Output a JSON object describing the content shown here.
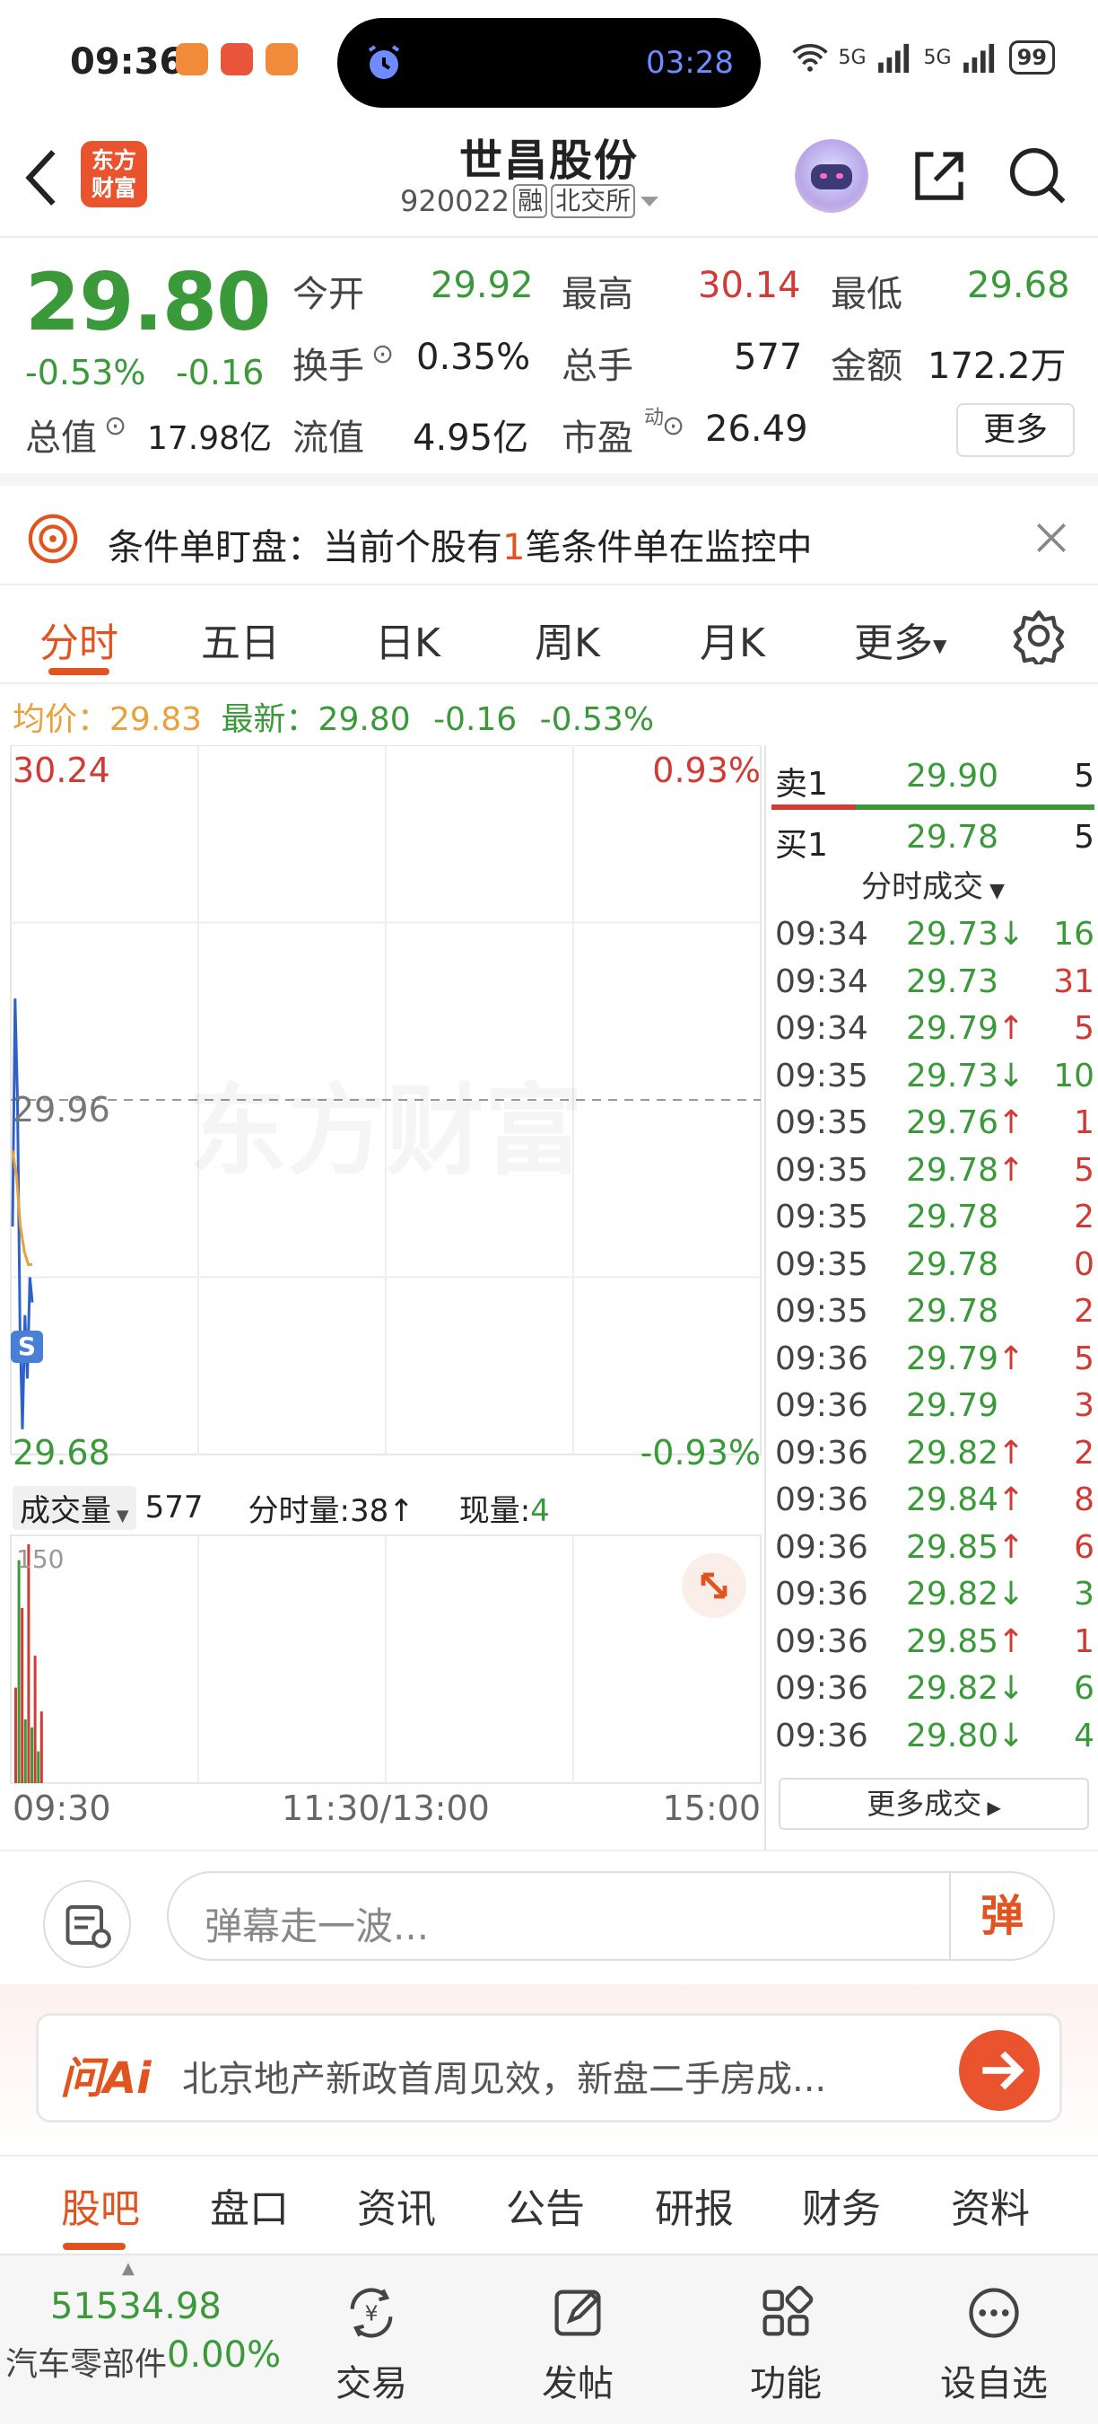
{
  "status_bar": {
    "time": "09:36",
    "island_time": "03:28",
    "battery": "99",
    "net1": "5G",
    "net2": "5G"
  },
  "header": {
    "logo_text": "东方财富",
    "stock_name": "世昌股份",
    "code": "920022",
    "tag_margin": "融",
    "tag_exchange": "北交所"
  },
  "quote": {
    "price": "29.80",
    "change_pct": "-0.53%",
    "change": "-0.16",
    "open_label": "今开",
    "open": "29.92",
    "high_label": "最高",
    "high": "30.14",
    "low_label": "最低",
    "low": "29.68",
    "turnover_label": "换手",
    "turnover": "0.35%",
    "volume_label": "总手",
    "volume": "577",
    "amount_label": "金额",
    "amount": "172.2万",
    "mktcap_label": "总值",
    "mktcap": "17.98亿",
    "float_label": "流值",
    "float_cap": "4.95亿",
    "pe_label": "市盈",
    "pe_sup": "动",
    "pe": "26.49",
    "more": "更多"
  },
  "monitor": {
    "prefix": "条件单盯盘：当前个股有",
    "count": "1",
    "suffix": "笔条件单在监控中"
  },
  "chart_tabs": [
    "分时",
    "五日",
    "日K",
    "周K",
    "月K",
    "更多"
  ],
  "avg": {
    "label": "均价：",
    "value": "29.83",
    "latest_label": "最新：",
    "latest": "29.80",
    "chg": "-0.16",
    "pct": "-0.53%"
  },
  "chart": {
    "high": "30.24",
    "high_pct": "0.93%",
    "mid": "29.96",
    "low": "29.68",
    "low_pct": "-0.93%",
    "watermark": "东方财富",
    "s_marker": "S",
    "vol_label": "成交量",
    "vol": "577",
    "fs_label": "分时量:38↑",
    "now_label": "现量:",
    "now": "4",
    "vol_axis": "150",
    "time_start": "09:30",
    "time_mid": "11:30/13:00",
    "time_end": "15:00"
  },
  "chart_data": {
    "type": "line",
    "title": "",
    "xlabel": "",
    "ylabel": "",
    "x_ticks": [
      "09:30",
      "11:30/13:00",
      "15:00"
    ],
    "ylim": [
      29.68,
      30.24
    ],
    "reference_price": 29.96,
    "series": [
      {
        "name": "",
        "color": "#2f62c8",
        "y": [
          29.86,
          30.04,
          29.96,
          29.78,
          29.7,
          29.79,
          29.74,
          29.82,
          29.8
        ]
      },
      {
        "name": "",
        "color": "#e6a23c",
        "y": [
          29.92,
          29.9,
          29.86,
          29.84,
          29.83,
          29.83
        ]
      }
    ],
    "volume": {
      "ylim": [
        0,
        150
      ],
      "bars": [
        60,
        140,
        110,
        40,
        150,
        35,
        80,
        20,
        45
      ]
    }
  },
  "orders": {
    "sell_label": "卖1",
    "sell_price": "29.90",
    "sell_vol": "5",
    "buy_label": "买1",
    "buy_price": "29.78",
    "buy_vol": "5",
    "ticks_label": "分时成交",
    "more_deals": "更多成交",
    "ticks": [
      {
        "t": "09:34",
        "p": "29.73",
        "d": "↓",
        "v": "16",
        "vc": "green"
      },
      {
        "t": "09:34",
        "p": "29.73",
        "d": "",
        "v": "31",
        "vc": "red"
      },
      {
        "t": "09:34",
        "p": "29.79",
        "d": "↑",
        "v": "5",
        "vc": "red"
      },
      {
        "t": "09:35",
        "p": "29.73",
        "d": "↓",
        "v": "10",
        "vc": "green"
      },
      {
        "t": "09:35",
        "p": "29.76",
        "d": "↑",
        "v": "1",
        "vc": "red"
      },
      {
        "t": "09:35",
        "p": "29.78",
        "d": "↑",
        "v": "5",
        "vc": "red"
      },
      {
        "t": "09:35",
        "p": "29.78",
        "d": "",
        "v": "2",
        "vc": "red"
      },
      {
        "t": "09:35",
        "p": "29.78",
        "d": "",
        "v": "0",
        "vc": "red"
      },
      {
        "t": "09:35",
        "p": "29.78",
        "d": "",
        "v": "2",
        "vc": "red"
      },
      {
        "t": "09:36",
        "p": "29.79",
        "d": "↑",
        "v": "5",
        "vc": "red"
      },
      {
        "t": "09:36",
        "p": "29.79",
        "d": "",
        "v": "3",
        "vc": "red"
      },
      {
        "t": "09:36",
        "p": "29.82",
        "d": "↑",
        "v": "2",
        "vc": "red"
      },
      {
        "t": "09:36",
        "p": "29.84",
        "d": "↑",
        "v": "8",
        "vc": "red"
      },
      {
        "t": "09:36",
        "p": "29.85",
        "d": "↑",
        "v": "6",
        "vc": "red"
      },
      {
        "t": "09:36",
        "p": "29.82",
        "d": "↓",
        "v": "3",
        "vc": "green"
      },
      {
        "t": "09:36",
        "p": "29.85",
        "d": "↑",
        "v": "1",
        "vc": "red"
      },
      {
        "t": "09:36",
        "p": "29.82",
        "d": "↓",
        "v": "6",
        "vc": "green"
      },
      {
        "t": "09:36",
        "p": "29.80",
        "d": "↓",
        "v": "4",
        "vc": "green"
      }
    ]
  },
  "comment": {
    "placeholder": "弹幕走一波...",
    "danmu": "弹"
  },
  "ai": {
    "logo": "问Ai",
    "question": "北京地产新政首周见效，新盘二手房成..."
  },
  "bottom_tabs": [
    "股吧",
    "盘口",
    "资讯",
    "公告",
    "研报",
    "财务",
    "资料"
  ],
  "footer": {
    "index_value": "51534.98",
    "index_name": "汽车零部件",
    "index_pct": "0.00%",
    "buttons": [
      "交易",
      "发帖",
      "功能",
      "设自选"
    ]
  },
  "colors": {
    "up": "#d23a35",
    "down": "#3a9a3a",
    "accent": "#e2541f",
    "price_line": "#2f62c8",
    "avg_line": "#e6a23c"
  }
}
